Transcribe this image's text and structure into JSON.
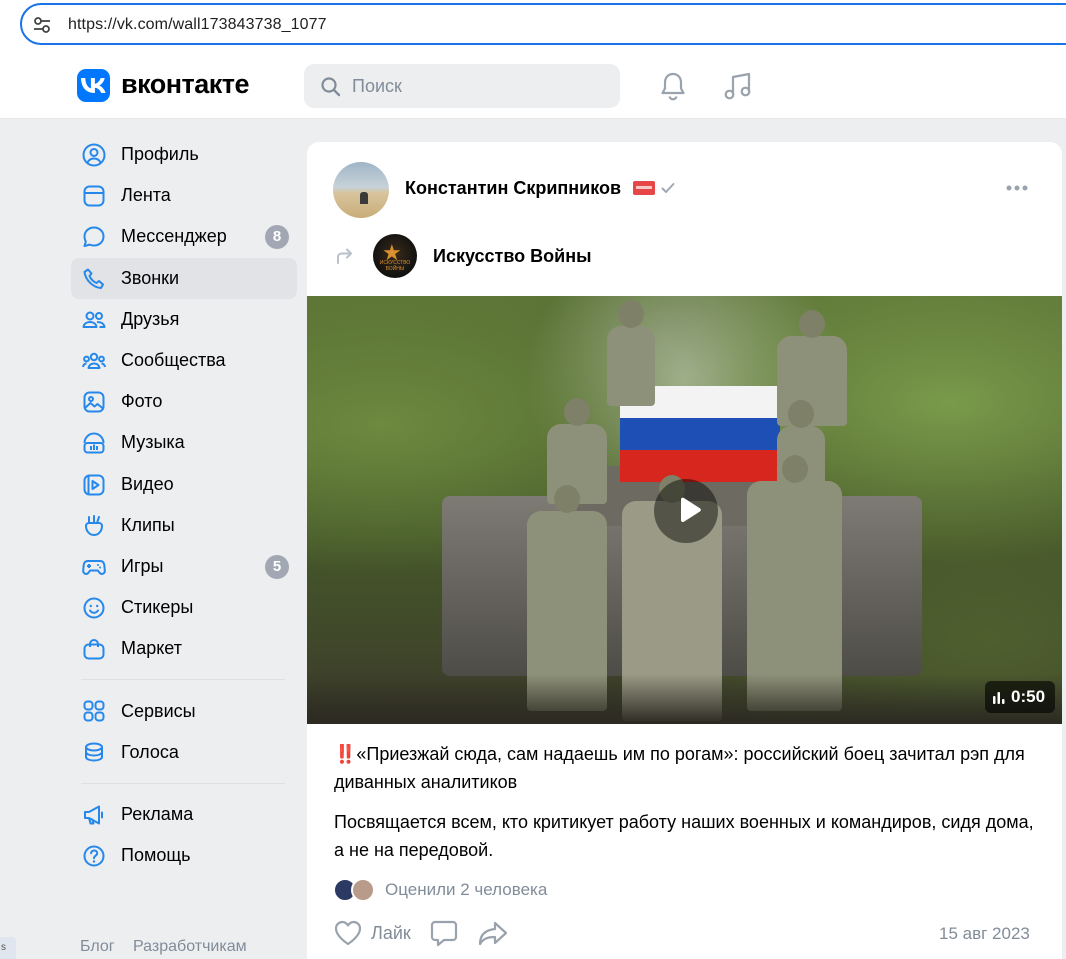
{
  "browser": {
    "url": "https://vk.com/wall173843738_1077"
  },
  "header": {
    "logo_text": "вконтакте",
    "search_placeholder": "Поиск"
  },
  "sidebar": {
    "items": [
      {
        "label": "Профиль",
        "icon": "profile-icon"
      },
      {
        "label": "Лента",
        "icon": "feed-icon"
      },
      {
        "label": "Мессенджер",
        "icon": "messenger-icon",
        "badge": "8"
      },
      {
        "label": "Звонки",
        "icon": "phone-icon",
        "active": true
      },
      {
        "label": "Друзья",
        "icon": "friends-icon"
      },
      {
        "label": "Сообщества",
        "icon": "communities-icon"
      },
      {
        "label": "Фото",
        "icon": "photo-icon"
      },
      {
        "label": "Музыка",
        "icon": "music-icon"
      },
      {
        "label": "Видео",
        "icon": "video-icon"
      },
      {
        "label": "Клипы",
        "icon": "clips-icon"
      },
      {
        "label": "Игры",
        "icon": "games-icon",
        "badge": "5"
      },
      {
        "label": "Стикеры",
        "icon": "stickers-icon"
      },
      {
        "label": "Маркет",
        "icon": "market-icon"
      }
    ],
    "items2": [
      {
        "label": "Сервисы",
        "icon": "services-icon"
      },
      {
        "label": "Голоса",
        "icon": "votes-icon"
      }
    ],
    "items3": [
      {
        "label": "Реклама",
        "icon": "ads-icon"
      },
      {
        "label": "Помощь",
        "icon": "help-icon"
      }
    ],
    "footer_links": [
      "Блог",
      "Разработчикам"
    ],
    "corner_tab": "s"
  },
  "post": {
    "author": "Константин Скрипников",
    "repost_group": "Искусство Войны",
    "group_avatar_text": "ИСКУССТВО ВОЙНЫ",
    "video_duration": "0:50",
    "title_prefix": "‼️",
    "title": "«Приезжай сюда, сам надаешь им по рогам»: российский боец зачитал рэп для диванных аналитиков",
    "body": "Посвящается всем, кто критикует работу наших военных и командиров, сидя дома, а не на передовой.",
    "likers_text": "Оценили 2 человека",
    "like_label": "Лайк",
    "date": "15 авг 2023"
  },
  "colors": {
    "accent": "#0077ff",
    "muted": "#818c99",
    "background": "#edeef0",
    "badge": "#a2a8b3"
  }
}
